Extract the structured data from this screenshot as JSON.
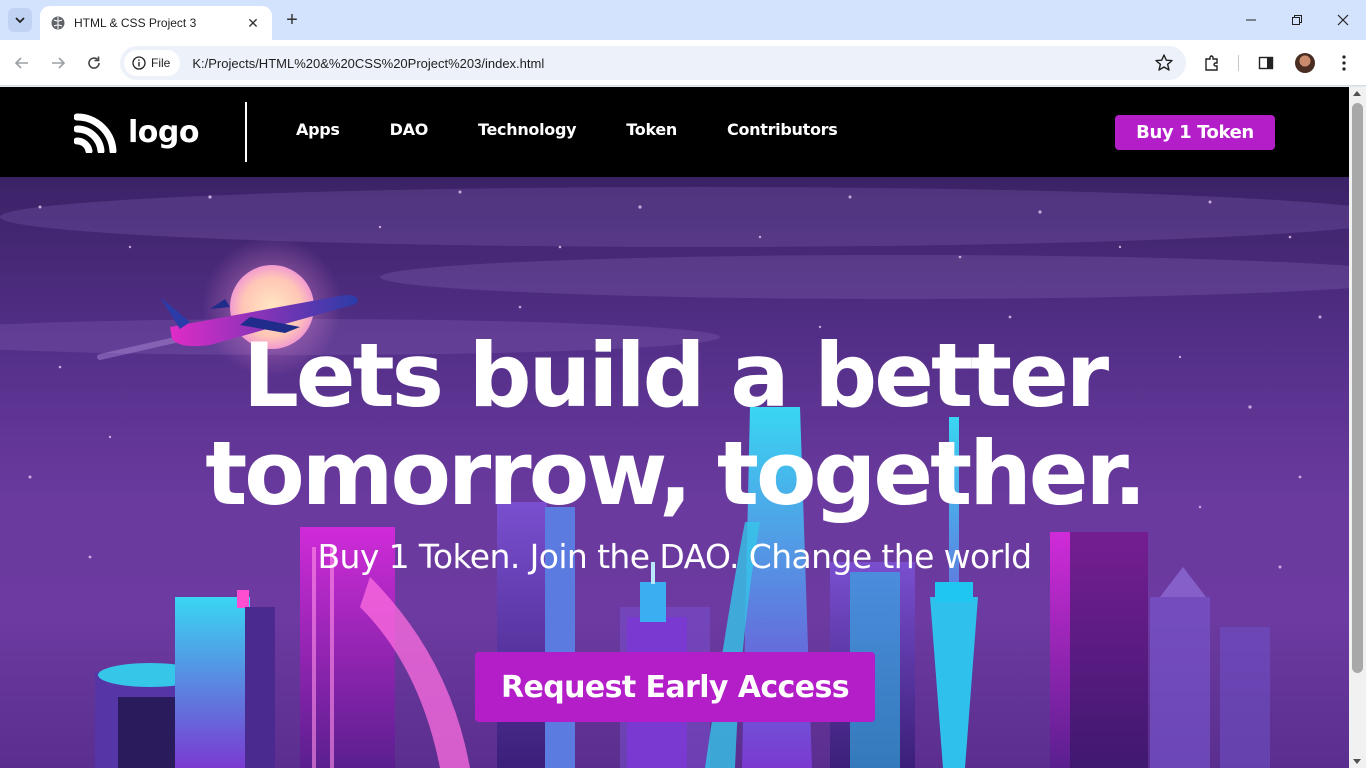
{
  "browser": {
    "tab_title": "HTML & CSS Project 3",
    "tab_close": "✕",
    "new_tab": "+",
    "address_chip": "File",
    "url": "K:/Projects/HTML%20&%20CSS%20Project%203/index.html"
  },
  "site": {
    "logo_text": "logo",
    "nav": [
      {
        "label": "Apps"
      },
      {
        "label": "DAO"
      },
      {
        "label": "Technology"
      },
      {
        "label": "Token"
      },
      {
        "label": "Contributors"
      }
    ],
    "buy_button": "Buy 1 Token"
  },
  "hero": {
    "headline_line1": "Lets build a better",
    "headline_line2": "tomorrow, together.",
    "subheading": "Buy 1 Token. Join the DAO. Change the world",
    "cta": "Request Early Access"
  },
  "colors": {
    "accent": "#b41ec9",
    "header_bg": "#000000",
    "tabstrip_bg": "#d3e2fd"
  }
}
